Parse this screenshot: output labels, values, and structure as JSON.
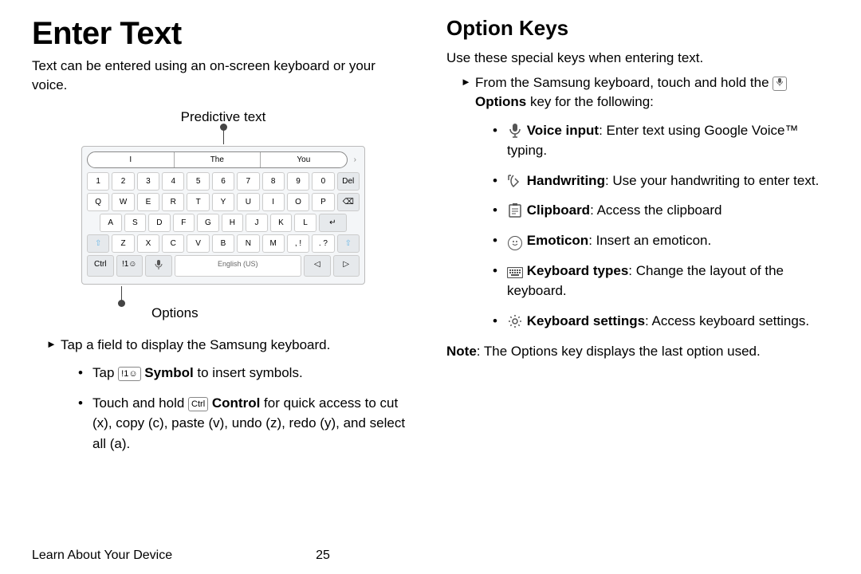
{
  "left": {
    "heading": "Enter Text",
    "intro": "Text can be entered using an on-screen keyboard or your voice.",
    "predictive_label": "Predictive text",
    "options_label": "Options",
    "predictions": [
      "I",
      "The",
      "You"
    ],
    "row_num": [
      "1",
      "2",
      "3",
      "4",
      "5",
      "6",
      "7",
      "8",
      "9",
      "0"
    ],
    "del": "Del",
    "row_q": [
      "Q",
      "W",
      "E",
      "R",
      "T",
      "Y",
      "U",
      "I",
      "O",
      "P"
    ],
    "row_a": [
      "A",
      "S",
      "D",
      "F",
      "G",
      "H",
      "J",
      "K",
      "L"
    ],
    "row_z": [
      "Z",
      "X",
      "C",
      "V",
      "B",
      "N",
      "M"
    ],
    "punct1": ", !",
    "punct2": ". ?",
    "ctrl": "Ctrl",
    "sym": "!1☺",
    "space": "English (US)",
    "tap_field": "Tap a field to display the Samsung keyboard.",
    "tap_pre": "Tap ",
    "sym_key": "!1☺",
    "symbol_b": "Symbol",
    "symbol_post": " to insert symbols.",
    "ctrl_pre": "Touch and hold ",
    "ctrl_key": "Ctrl",
    "control_b": "Control",
    "ctrl_post": " for quick access to cut (x), copy (c), paste (v), undo (z), redo (y), and select all (a)."
  },
  "right": {
    "heading": "Option Keys",
    "intro": "Use these special keys when entering text.",
    "from_pre": "From the Samsung keyboard, touch and hold the ",
    "options_b": "Options",
    "from_post": " key for the following:",
    "voice_b": "Voice input",
    "voice_t": ": Enter text using Google Voice™ typing.",
    "hand_b": "Handwriting",
    "hand_t": ": Use your handwriting to enter text.",
    "clip_b": "Clipboard",
    "clip_t": ": Access the clipboard",
    "emo_b": "Emoticon",
    "emo_t": ": Insert an emoticon.",
    "kt_b": "Keyboard types",
    "kt_t": ": Change the layout of the keyboard.",
    "ks_b": "Keyboard settings",
    "ks_t": ": Access keyboard settings.",
    "note_b": "Note",
    "note_t": ": The Options key displays the last option used."
  },
  "footer": {
    "section": "Learn About Your Device",
    "page": "25"
  }
}
